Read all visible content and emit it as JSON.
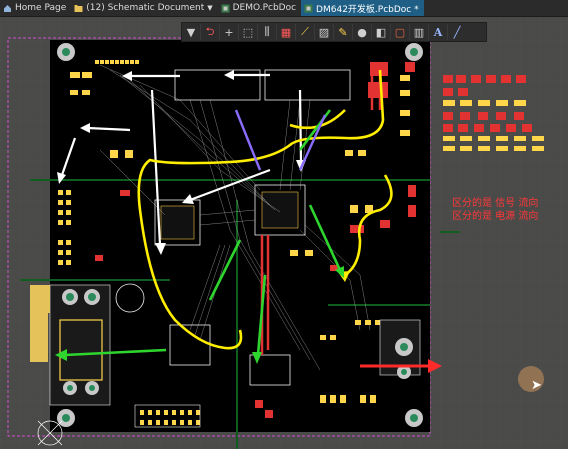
{
  "tabs": [
    {
      "label": "Home Page",
      "icon": "home-icon",
      "active": false
    },
    {
      "label": "(12) Schematic Document",
      "icon": "folder-icon",
      "active": false,
      "dropdown": true
    },
    {
      "label": "DEMO.PcbDoc",
      "icon": "pcb-icon",
      "active": false
    },
    {
      "label": "DM642开发板.PcbDoc *",
      "icon": "pcb-icon",
      "active": true
    }
  ],
  "toolbar": {
    "tools": [
      "filter-icon",
      "route-icon",
      "cross-icon",
      "select-rect-icon",
      "align-icon",
      "component-icon",
      "ruler-icon",
      "poly-icon",
      "highlight-icon",
      "via-icon",
      "pad-icon",
      "rect-icon",
      "chart-icon",
      "text-icon",
      "line-icon"
    ]
  },
  "annotations": {
    "line1": "区分的是 信号 流向",
    "line2": "区分的是 电源 流向"
  },
  "colors": {
    "board": "#000000",
    "outline": "#d14fd1",
    "pad": "#ffd54a",
    "top_copper": "#e33232",
    "silk": "#f0f0f0",
    "signal_arrow": "#ffffff",
    "power_arrow": "#ffee00",
    "green_arrow": "#2fd52f"
  }
}
